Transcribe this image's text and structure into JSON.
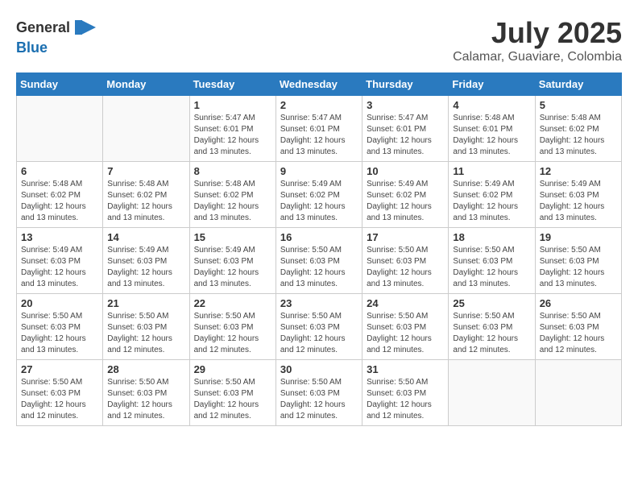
{
  "header": {
    "logo_general": "General",
    "logo_blue": "Blue",
    "month_year": "July 2025",
    "location": "Calamar, Guaviare, Colombia"
  },
  "weekdays": [
    "Sunday",
    "Monday",
    "Tuesday",
    "Wednesday",
    "Thursday",
    "Friday",
    "Saturday"
  ],
  "weeks": [
    [
      {
        "day": "",
        "info": ""
      },
      {
        "day": "",
        "info": ""
      },
      {
        "day": "1",
        "info": "Sunrise: 5:47 AM\nSunset: 6:01 PM\nDaylight: 12 hours\nand 13 minutes."
      },
      {
        "day": "2",
        "info": "Sunrise: 5:47 AM\nSunset: 6:01 PM\nDaylight: 12 hours\nand 13 minutes."
      },
      {
        "day": "3",
        "info": "Sunrise: 5:47 AM\nSunset: 6:01 PM\nDaylight: 12 hours\nand 13 minutes."
      },
      {
        "day": "4",
        "info": "Sunrise: 5:48 AM\nSunset: 6:01 PM\nDaylight: 12 hours\nand 13 minutes."
      },
      {
        "day": "5",
        "info": "Sunrise: 5:48 AM\nSunset: 6:02 PM\nDaylight: 12 hours\nand 13 minutes."
      }
    ],
    [
      {
        "day": "6",
        "info": "Sunrise: 5:48 AM\nSunset: 6:02 PM\nDaylight: 12 hours\nand 13 minutes."
      },
      {
        "day": "7",
        "info": "Sunrise: 5:48 AM\nSunset: 6:02 PM\nDaylight: 12 hours\nand 13 minutes."
      },
      {
        "day": "8",
        "info": "Sunrise: 5:48 AM\nSunset: 6:02 PM\nDaylight: 12 hours\nand 13 minutes."
      },
      {
        "day": "9",
        "info": "Sunrise: 5:49 AM\nSunset: 6:02 PM\nDaylight: 12 hours\nand 13 minutes."
      },
      {
        "day": "10",
        "info": "Sunrise: 5:49 AM\nSunset: 6:02 PM\nDaylight: 12 hours\nand 13 minutes."
      },
      {
        "day": "11",
        "info": "Sunrise: 5:49 AM\nSunset: 6:02 PM\nDaylight: 12 hours\nand 13 minutes."
      },
      {
        "day": "12",
        "info": "Sunrise: 5:49 AM\nSunset: 6:03 PM\nDaylight: 12 hours\nand 13 minutes."
      }
    ],
    [
      {
        "day": "13",
        "info": "Sunrise: 5:49 AM\nSunset: 6:03 PM\nDaylight: 12 hours\nand 13 minutes."
      },
      {
        "day": "14",
        "info": "Sunrise: 5:49 AM\nSunset: 6:03 PM\nDaylight: 12 hours\nand 13 minutes."
      },
      {
        "day": "15",
        "info": "Sunrise: 5:49 AM\nSunset: 6:03 PM\nDaylight: 12 hours\nand 13 minutes."
      },
      {
        "day": "16",
        "info": "Sunrise: 5:50 AM\nSunset: 6:03 PM\nDaylight: 12 hours\nand 13 minutes."
      },
      {
        "day": "17",
        "info": "Sunrise: 5:50 AM\nSunset: 6:03 PM\nDaylight: 12 hours\nand 13 minutes."
      },
      {
        "day": "18",
        "info": "Sunrise: 5:50 AM\nSunset: 6:03 PM\nDaylight: 12 hours\nand 13 minutes."
      },
      {
        "day": "19",
        "info": "Sunrise: 5:50 AM\nSunset: 6:03 PM\nDaylight: 12 hours\nand 13 minutes."
      }
    ],
    [
      {
        "day": "20",
        "info": "Sunrise: 5:50 AM\nSunset: 6:03 PM\nDaylight: 12 hours\nand 13 minutes."
      },
      {
        "day": "21",
        "info": "Sunrise: 5:50 AM\nSunset: 6:03 PM\nDaylight: 12 hours\nand 12 minutes."
      },
      {
        "day": "22",
        "info": "Sunrise: 5:50 AM\nSunset: 6:03 PM\nDaylight: 12 hours\nand 12 minutes."
      },
      {
        "day": "23",
        "info": "Sunrise: 5:50 AM\nSunset: 6:03 PM\nDaylight: 12 hours\nand 12 minutes."
      },
      {
        "day": "24",
        "info": "Sunrise: 5:50 AM\nSunset: 6:03 PM\nDaylight: 12 hours\nand 12 minutes."
      },
      {
        "day": "25",
        "info": "Sunrise: 5:50 AM\nSunset: 6:03 PM\nDaylight: 12 hours\nand 12 minutes."
      },
      {
        "day": "26",
        "info": "Sunrise: 5:50 AM\nSunset: 6:03 PM\nDaylight: 12 hours\nand 12 minutes."
      }
    ],
    [
      {
        "day": "27",
        "info": "Sunrise: 5:50 AM\nSunset: 6:03 PM\nDaylight: 12 hours\nand 12 minutes."
      },
      {
        "day": "28",
        "info": "Sunrise: 5:50 AM\nSunset: 6:03 PM\nDaylight: 12 hours\nand 12 minutes."
      },
      {
        "day": "29",
        "info": "Sunrise: 5:50 AM\nSunset: 6:03 PM\nDaylight: 12 hours\nand 12 minutes."
      },
      {
        "day": "30",
        "info": "Sunrise: 5:50 AM\nSunset: 6:03 PM\nDaylight: 12 hours\nand 12 minutes."
      },
      {
        "day": "31",
        "info": "Sunrise: 5:50 AM\nSunset: 6:03 PM\nDaylight: 12 hours\nand 12 minutes."
      },
      {
        "day": "",
        "info": ""
      },
      {
        "day": "",
        "info": ""
      }
    ]
  ]
}
